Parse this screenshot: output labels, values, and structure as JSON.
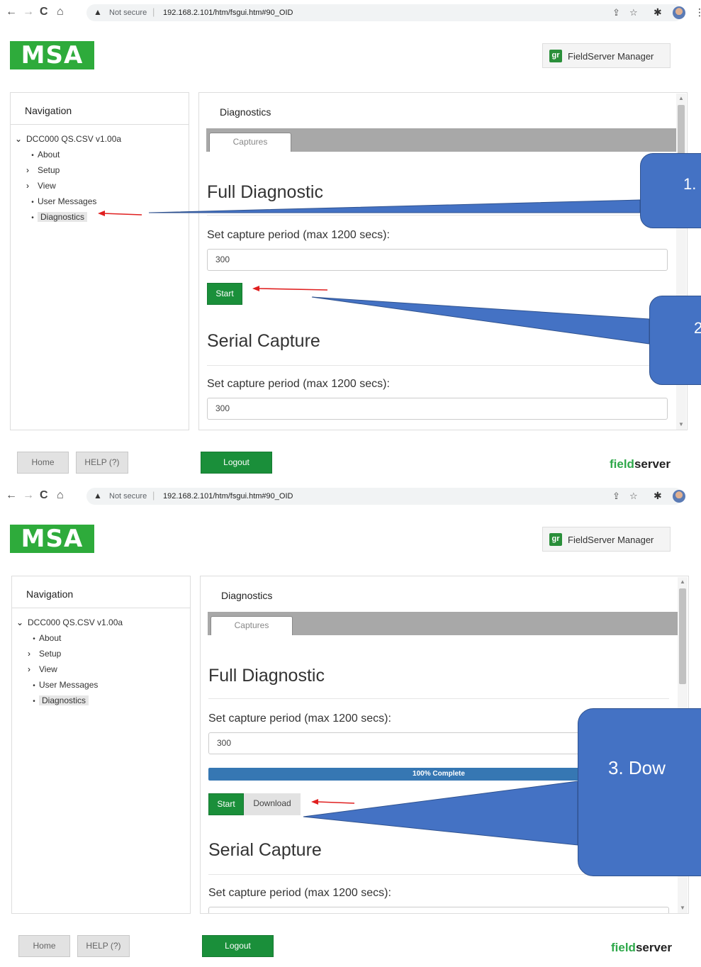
{
  "browser": {
    "security_label": "Not secure",
    "url": "192.168.2.101/htm/fsgui.htm#90_OID"
  },
  "header": {
    "logo_text": "MSA",
    "fsm_icon_text": "gr",
    "fsm_label": "FieldServer Manager"
  },
  "navigation": {
    "title": "Navigation",
    "root": "DCC000 QS.CSV v1.00a",
    "items": [
      "About",
      "Setup",
      "View",
      "User Messages",
      "Diagnostics"
    ]
  },
  "diagnostics": {
    "title": "Diagnostics",
    "tab": "Captures",
    "full_heading": "Full Diagnostic",
    "period_label": "Set capture period (max 1200 secs):",
    "period_value": "300",
    "start_label": "Start",
    "download_label": "Download",
    "serial_heading": "Serial Capture",
    "serial_period_value": "300",
    "progress_text": "100% Complete",
    "progress_fraction": 1.0
  },
  "footer": {
    "home_label": "Home",
    "help_label": "HELP (?)",
    "logout_label": "Logout",
    "brand_green": "field",
    "brand_dark": "server"
  },
  "callouts": {
    "c1": "1.",
    "c2": "2",
    "c3": "3. Dow"
  },
  "colors": {
    "msa_green": "#2eab3b",
    "button_green": "#1a8f3a",
    "callout_blue": "#4472c4",
    "progress_blue": "#3677b3",
    "arrow_red": "#e02020"
  }
}
